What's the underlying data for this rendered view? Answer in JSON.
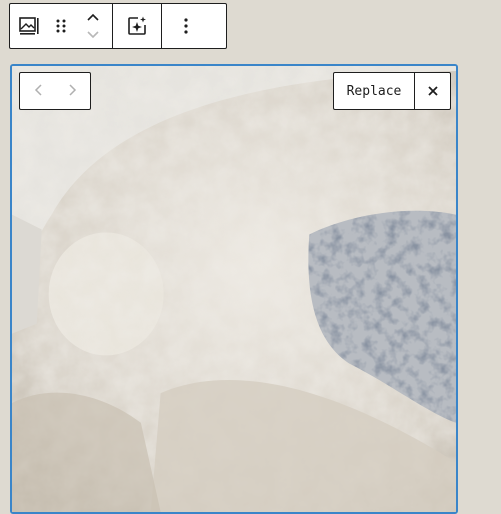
{
  "toolbar": {
    "icons": [
      "image-caption-icon",
      "drag-handle-icon",
      "chevron-up-icon",
      "chevron-down-icon",
      "ai-sparkle-icon",
      "more-options-icon"
    ]
  },
  "image_block": {
    "nav": {
      "prev_icon": "chevron-left-icon",
      "next_icon": "chevron-right-icon"
    },
    "replace_label": "Replace",
    "close_icon": "close-icon"
  },
  "colors": {
    "background": "#dedad1",
    "toolbar_border": "#1e1e1e",
    "selection_outline": "#3a85c9"
  }
}
